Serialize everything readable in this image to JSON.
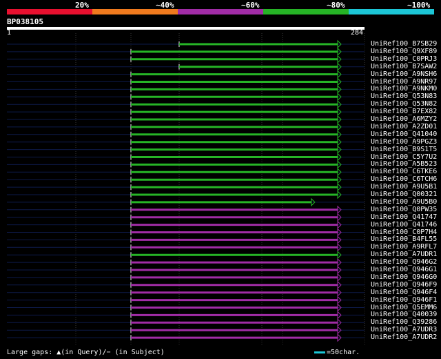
{
  "title": "BP038105",
  "legend": [
    {
      "label": "20%",
      "color": "#e8102f"
    },
    {
      "label": "~40%",
      "color": "#f07a1e"
    },
    {
      "label": "~60%",
      "color": "#a12ca6"
    },
    {
      "label": "~80%",
      "color": "#26b426"
    },
    {
      "label": "~100%",
      "color": "#1cc6d6"
    }
  ],
  "query": {
    "start_label": "1",
    "end_label": "284",
    "length": 284
  },
  "colors": {
    "green": "#26b426",
    "purple": "#a12ca6",
    "dark_line": "#0d1a4a",
    "gap": "#2a6a2a"
  },
  "hits": [
    {
      "id": "UniRef100_B7SB29",
      "start": 67,
      "end": 284,
      "group": "green",
      "gap_at": 67
    },
    {
      "id": "UniRef100_Q9XF89",
      "start": 1,
      "end": 284,
      "group": "green"
    },
    {
      "id": "UniRef100_C0PRJ3",
      "start": 1,
      "end": 284,
      "group": "green"
    },
    {
      "id": "UniRef100_B7SAW2",
      "start": 67,
      "end": 284,
      "group": "green",
      "gap_at": 67
    },
    {
      "id": "UniRef100_A9NSH6",
      "start": 1,
      "end": 284,
      "group": "green"
    },
    {
      "id": "UniRef100_A9NR97",
      "start": 1,
      "end": 284,
      "group": "green"
    },
    {
      "id": "UniRef100_A9NKM0",
      "start": 1,
      "end": 284,
      "group": "green"
    },
    {
      "id": "UniRef100_Q53N83",
      "start": 1,
      "end": 284,
      "group": "green"
    },
    {
      "id": "UniRef100_Q53N82",
      "start": 1,
      "end": 284,
      "group": "green"
    },
    {
      "id": "UniRef100_B7EX82",
      "start": 1,
      "end": 284,
      "group": "green"
    },
    {
      "id": "UniRef100_A6MZY2",
      "start": 1,
      "end": 284,
      "group": "green"
    },
    {
      "id": "UniRef100_A2ZD01",
      "start": 1,
      "end": 284,
      "group": "green"
    },
    {
      "id": "UniRef100_Q41040",
      "start": 1,
      "end": 284,
      "group": "green"
    },
    {
      "id": "UniRef100_A9PGZ3",
      "start": 1,
      "end": 284,
      "group": "green"
    },
    {
      "id": "UniRef100_B9S1T5",
      "start": 1,
      "end": 284,
      "group": "green"
    },
    {
      "id": "UniRef100_C5Y7U2",
      "start": 1,
      "end": 284,
      "group": "green"
    },
    {
      "id": "UniRef100_A5B523",
      "start": 1,
      "end": 284,
      "group": "green"
    },
    {
      "id": "UniRef100_C6TKE6",
      "start": 1,
      "end": 284,
      "group": "green"
    },
    {
      "id": "UniRef100_C6TCH6",
      "start": 1,
      "end": 284,
      "group": "green"
    },
    {
      "id": "UniRef100_A9U5B1",
      "start": 1,
      "end": 284,
      "group": "green"
    },
    {
      "id": "UniRef100_Q00321",
      "start": 1,
      "end": 284,
      "group": "green"
    },
    {
      "id": "UniRef100_A9U5B0",
      "start": 1,
      "end": 248,
      "group": "green"
    },
    {
      "id": "UniRef100_Q0PW35",
      "start": 1,
      "end": 284,
      "group": "purple"
    },
    {
      "id": "UniRef100_Q41747",
      "start": 1,
      "end": 284,
      "group": "purple"
    },
    {
      "id": "UniRef100_Q41746",
      "start": 1,
      "end": 284,
      "group": "purple"
    },
    {
      "id": "UniRef100_C0P7H4",
      "start": 1,
      "end": 284,
      "group": "purple"
    },
    {
      "id": "UniRef100_B4FL55",
      "start": 1,
      "end": 284,
      "group": "purple"
    },
    {
      "id": "UniRef100_A9RFL7",
      "start": 1,
      "end": 284,
      "group": "purple"
    },
    {
      "id": "UniRef100_A7UDR1",
      "start": 1,
      "end": 284,
      "group": "green"
    },
    {
      "id": "UniRef100_Q946G2",
      "start": 1,
      "end": 284,
      "group": "purple"
    },
    {
      "id": "UniRef100_Q946G1",
      "start": 1,
      "end": 284,
      "group": "purple"
    },
    {
      "id": "UniRef100_Q946G0",
      "start": 1,
      "end": 284,
      "group": "purple"
    },
    {
      "id": "UniRef100_Q946F9",
      "start": 1,
      "end": 284,
      "group": "purple"
    },
    {
      "id": "UniRef100_Q946F4",
      "start": 1,
      "end": 284,
      "group": "purple"
    },
    {
      "id": "UniRef100_Q946F1",
      "start": 1,
      "end": 284,
      "group": "purple"
    },
    {
      "id": "UniRef100_Q5EMM6",
      "start": 1,
      "end": 284,
      "group": "purple"
    },
    {
      "id": "UniRef100_Q40039",
      "start": 1,
      "end": 284,
      "group": "purple"
    },
    {
      "id": "UniRef100_Q39286",
      "start": 1,
      "end": 284,
      "group": "purple"
    },
    {
      "id": "UniRef100_A7UDR3",
      "start": 1,
      "end": 284,
      "group": "purple"
    },
    {
      "id": "UniRef100_A7UDR2",
      "start": 1,
      "end": 284,
      "group": "purple"
    }
  ],
  "footer": {
    "gaps_text": "Large gaps: ▲(in Query)/− (in Subject)",
    "scale_text": "=50char."
  }
}
